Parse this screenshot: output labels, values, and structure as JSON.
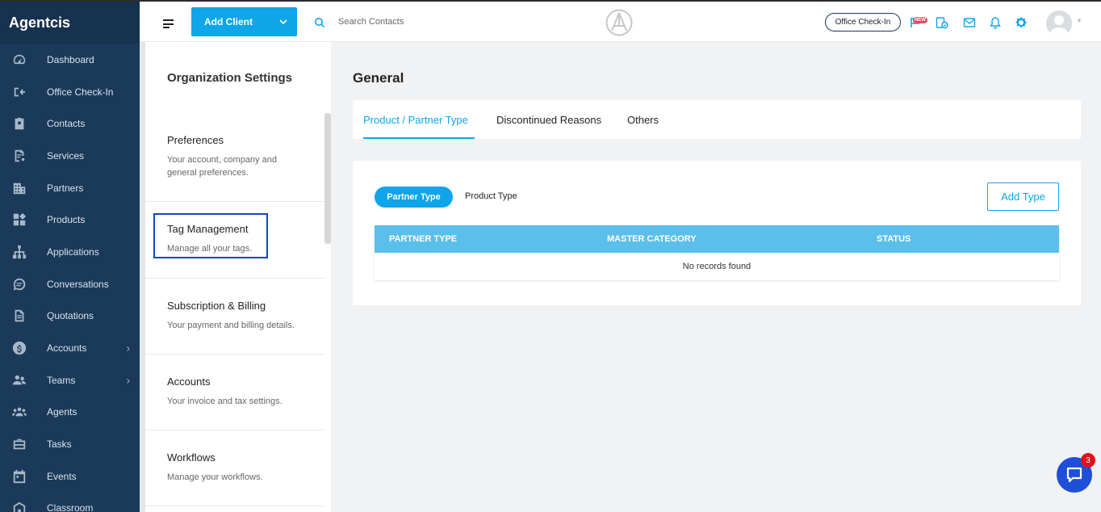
{
  "app": {
    "brand": "Agentcis"
  },
  "sidebar": {
    "items": [
      {
        "label": "Dashboard",
        "icon": "gauge-icon",
        "has_submenu": false
      },
      {
        "label": "Office Check-In",
        "icon": "checkin-icon",
        "has_submenu": false
      },
      {
        "label": "Contacts",
        "icon": "contact-card-icon",
        "has_submenu": false
      },
      {
        "label": "Services",
        "icon": "services-icon",
        "has_submenu": false
      },
      {
        "label": "Partners",
        "icon": "building-icon",
        "has_submenu": false
      },
      {
        "label": "Products",
        "icon": "products-icon",
        "has_submenu": false
      },
      {
        "label": "Applications",
        "icon": "flow-icon",
        "has_submenu": false
      },
      {
        "label": "Conversations",
        "icon": "chat-bubble-icon",
        "has_submenu": false
      },
      {
        "label": "Quotations",
        "icon": "document-icon",
        "has_submenu": false
      },
      {
        "label": "Accounts",
        "icon": "dollar-icon",
        "has_submenu": true
      },
      {
        "label": "Teams",
        "icon": "team-icon",
        "has_submenu": true
      },
      {
        "label": "Agents",
        "icon": "agents-icon",
        "has_submenu": false
      },
      {
        "label": "Tasks",
        "icon": "briefcase-icon",
        "has_submenu": false
      },
      {
        "label": "Events",
        "icon": "calendar-icon",
        "has_submenu": false
      },
      {
        "label": "Classroom",
        "icon": "classroom-icon",
        "has_submenu": false
      }
    ]
  },
  "topbar": {
    "add_client_label": "Add Client",
    "search_placeholder": "Search Contacts",
    "checkin_label": "Office Check-In",
    "new_badge": "NEW"
  },
  "settings": {
    "title": "Organization Settings",
    "items": [
      {
        "title": "Preferences",
        "desc": "Your account, company and general preferences."
      },
      {
        "title": "Tag Management",
        "desc": "Manage all your tags."
      },
      {
        "title": "Subscription & Billing",
        "desc": "Your payment and billing details."
      },
      {
        "title": "Accounts",
        "desc": "Your invoice and tax settings."
      },
      {
        "title": "Workflows",
        "desc": "Manage your workflows."
      }
    ]
  },
  "main": {
    "title": "General",
    "tabs": [
      {
        "label": "Product / Partner Type",
        "active": true
      },
      {
        "label": "Discontinued Reasons",
        "active": false
      },
      {
        "label": "Others",
        "active": false
      }
    ],
    "toggle": {
      "active": "Partner Type",
      "inactive": "Product Type"
    },
    "add_button": "Add Type",
    "table": {
      "columns": [
        "PARTNER TYPE",
        "MASTER CATEGORY",
        "STATUS"
      ],
      "empty_text": "No records found"
    }
  },
  "chat": {
    "badge_count": "3"
  },
  "colors": {
    "sidebar": "#1b3a5a",
    "accent": "#0ea5e9",
    "table_header": "#5bbfec",
    "highlight": "#0e46c8"
  }
}
